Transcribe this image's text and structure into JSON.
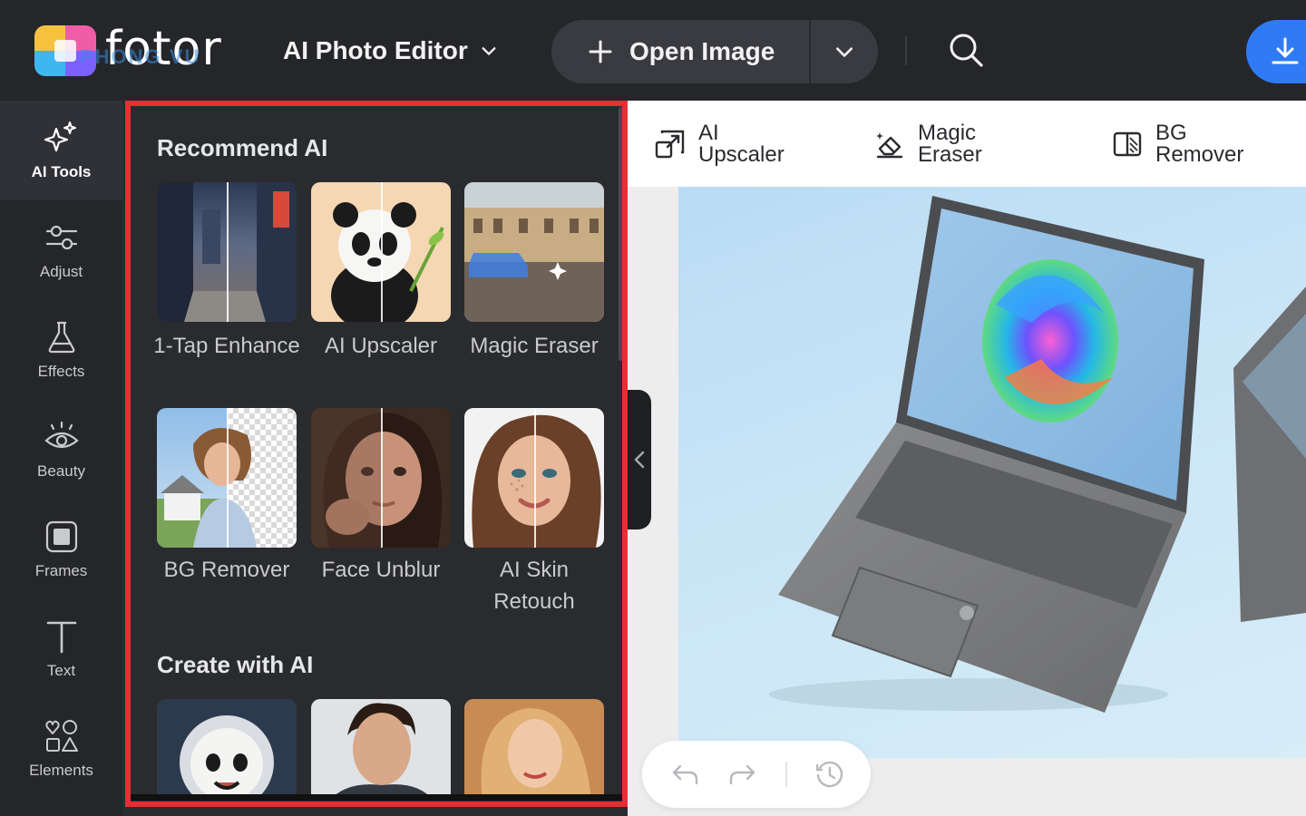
{
  "app": {
    "logo_text": "fotor",
    "watermark_text": "PHONG VU",
    "editor_switch_label": "AI Photo Editor"
  },
  "toolbar": {
    "open_image_label": "Open Image"
  },
  "rail": {
    "items": [
      {
        "label": "AI Tools",
        "icon": "sparkle-icon",
        "active": true
      },
      {
        "label": "Adjust",
        "icon": "sliders-icon"
      },
      {
        "label": "Effects",
        "icon": "flask-icon"
      },
      {
        "label": "Beauty",
        "icon": "eye-icon"
      },
      {
        "label": "Frames",
        "icon": "frame-icon"
      },
      {
        "label": "Text",
        "icon": "text-icon"
      },
      {
        "label": "Elements",
        "icon": "shapes-icon"
      }
    ]
  },
  "panel": {
    "recommend_title": "Recommend AI",
    "recommend_tools": [
      {
        "label": "1-Tap Enhance"
      },
      {
        "label": "AI Upscaler"
      },
      {
        "label": "Magic Eraser"
      },
      {
        "label": "BG Remover"
      },
      {
        "label": "Face Unblur"
      },
      {
        "label": "AI Skin Retouch"
      }
    ],
    "create_title": "Create with AI"
  },
  "quickbar": {
    "items": [
      {
        "label_line1": "AI",
        "label_line2": "Upscaler",
        "icon": "upscale-icon"
      },
      {
        "label_line1": "Magic",
        "label_line2": "Eraser",
        "icon": "eraser-icon"
      },
      {
        "label_line1": "BG",
        "label_line2": "Remover",
        "icon": "bg-remove-icon"
      }
    ]
  },
  "colors": {
    "accent": "#2f7bf5",
    "highlight_border": "#e82e33",
    "topbar_bg": "#25262a",
    "panel_bg": "#2a2b2f"
  }
}
